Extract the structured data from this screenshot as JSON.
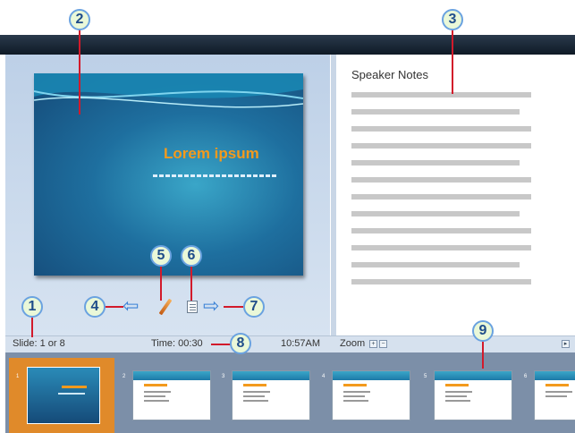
{
  "slide": {
    "title": "Lorem ipsum"
  },
  "notes": {
    "title": "Speaker Notes"
  },
  "status": {
    "slide_counter": "Slide: 1 or 8",
    "time": "Time: 00:30",
    "clock": "10:57AM",
    "zoom_label": "Zoom"
  },
  "controls": {
    "previous_icon": "arrow-left-icon",
    "pen_icon": "pen-icon",
    "notes_icon": "notes-icon",
    "next_icon": "arrow-right-icon"
  },
  "thumbnails": {
    "numbers": [
      "1",
      "2",
      "3",
      "4",
      "5",
      "6"
    ],
    "selected": "1"
  },
  "callouts": [
    "1",
    "2",
    "3",
    "4",
    "5",
    "6",
    "7",
    "8",
    "9"
  ],
  "colors": {
    "slide_title": "#f39a1d",
    "callout_border": "#6aa2e0",
    "callout_line": "#d21a2b",
    "selected_thumbnail": "#e08a2a"
  }
}
